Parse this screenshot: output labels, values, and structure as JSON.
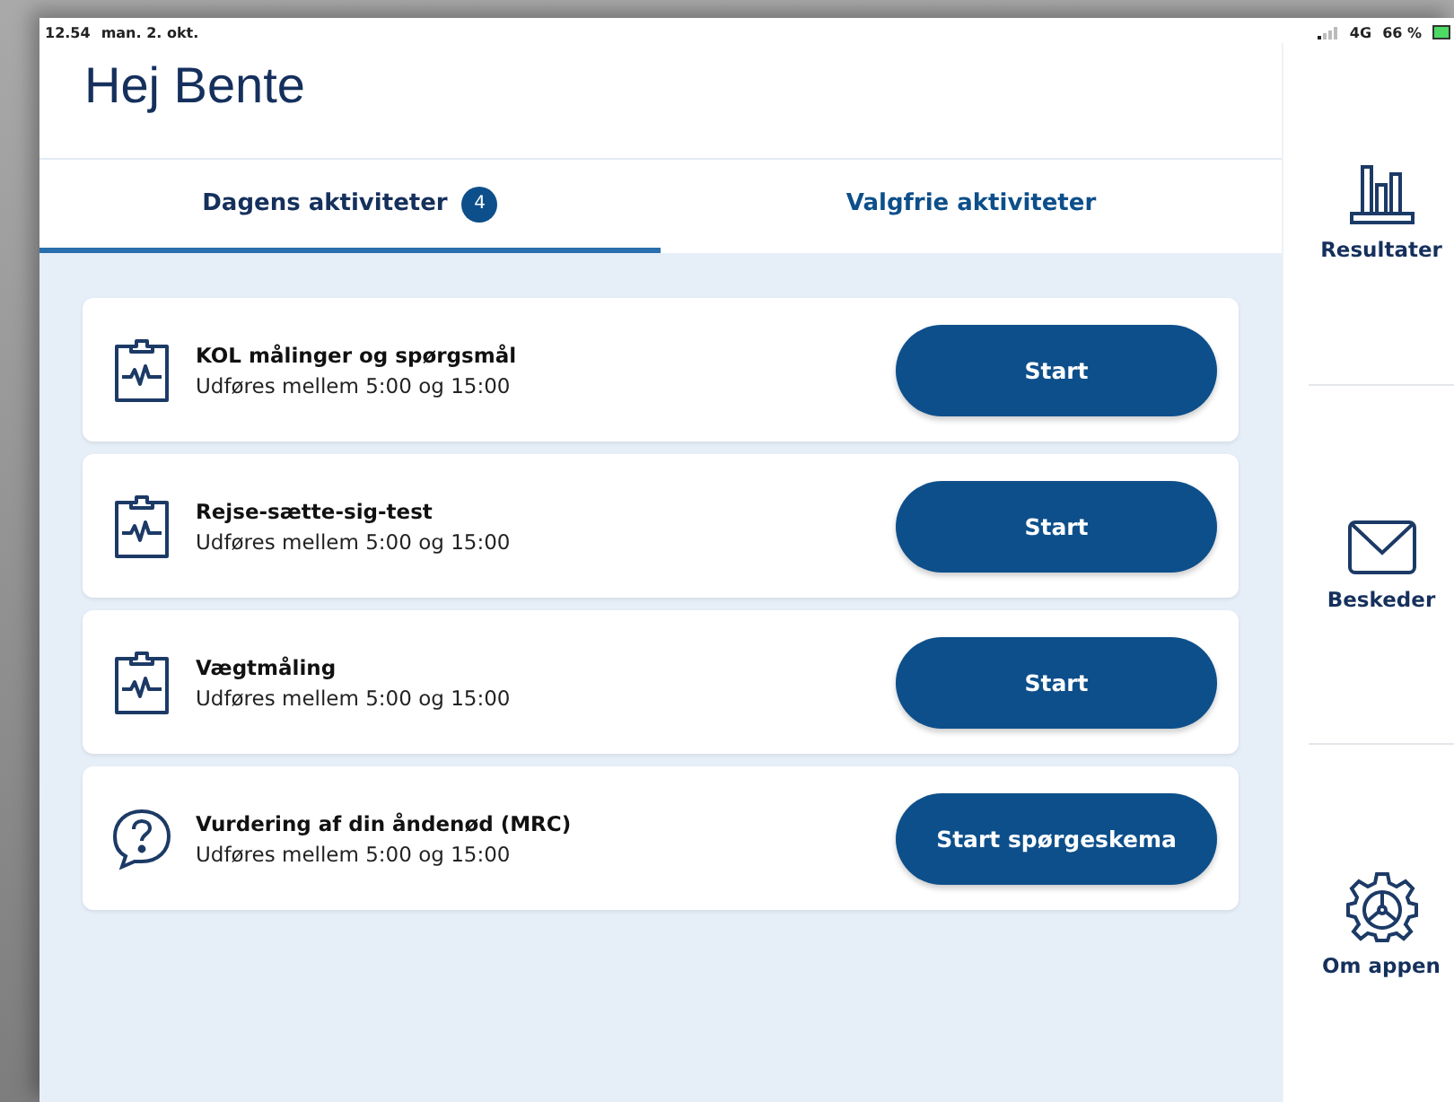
{
  "status_bar": {
    "time": "12.54",
    "date": "man. 2. okt.",
    "network": "4G",
    "battery": "66 %"
  },
  "header": {
    "title": "Hej Bente"
  },
  "tabs": [
    {
      "label": "Dagens aktiviteter",
      "badge": "4",
      "selected": true
    },
    {
      "label": "Valgfrie aktiviteter",
      "selected": false
    }
  ],
  "activities": [
    {
      "kind": "measurement",
      "title": "KOL målinger og spørgsmål",
      "subtitle": "Udføres mellem 5:00 og 15:00",
      "button": "Start"
    },
    {
      "kind": "measurement",
      "title": "Rejse-sætte-sig-test",
      "subtitle": "Udføres mellem 5:00 og 15:00",
      "button": "Start"
    },
    {
      "kind": "measurement",
      "title": "Vægtmåling",
      "subtitle": "Udføres mellem 5:00 og 15:00",
      "button": "Start"
    },
    {
      "kind": "questionnaire",
      "title": "Vurdering af din åndenød (MRC)",
      "subtitle": "Udføres mellem 5:00 og 15:00",
      "button": "Start spørgeskema"
    }
  ],
  "sidebar": {
    "items": [
      {
        "kind": "results",
        "label": "Resultater"
      },
      {
        "kind": "messages",
        "label": "Beskeder"
      },
      {
        "kind": "about",
        "label": "Om appen"
      }
    ]
  }
}
